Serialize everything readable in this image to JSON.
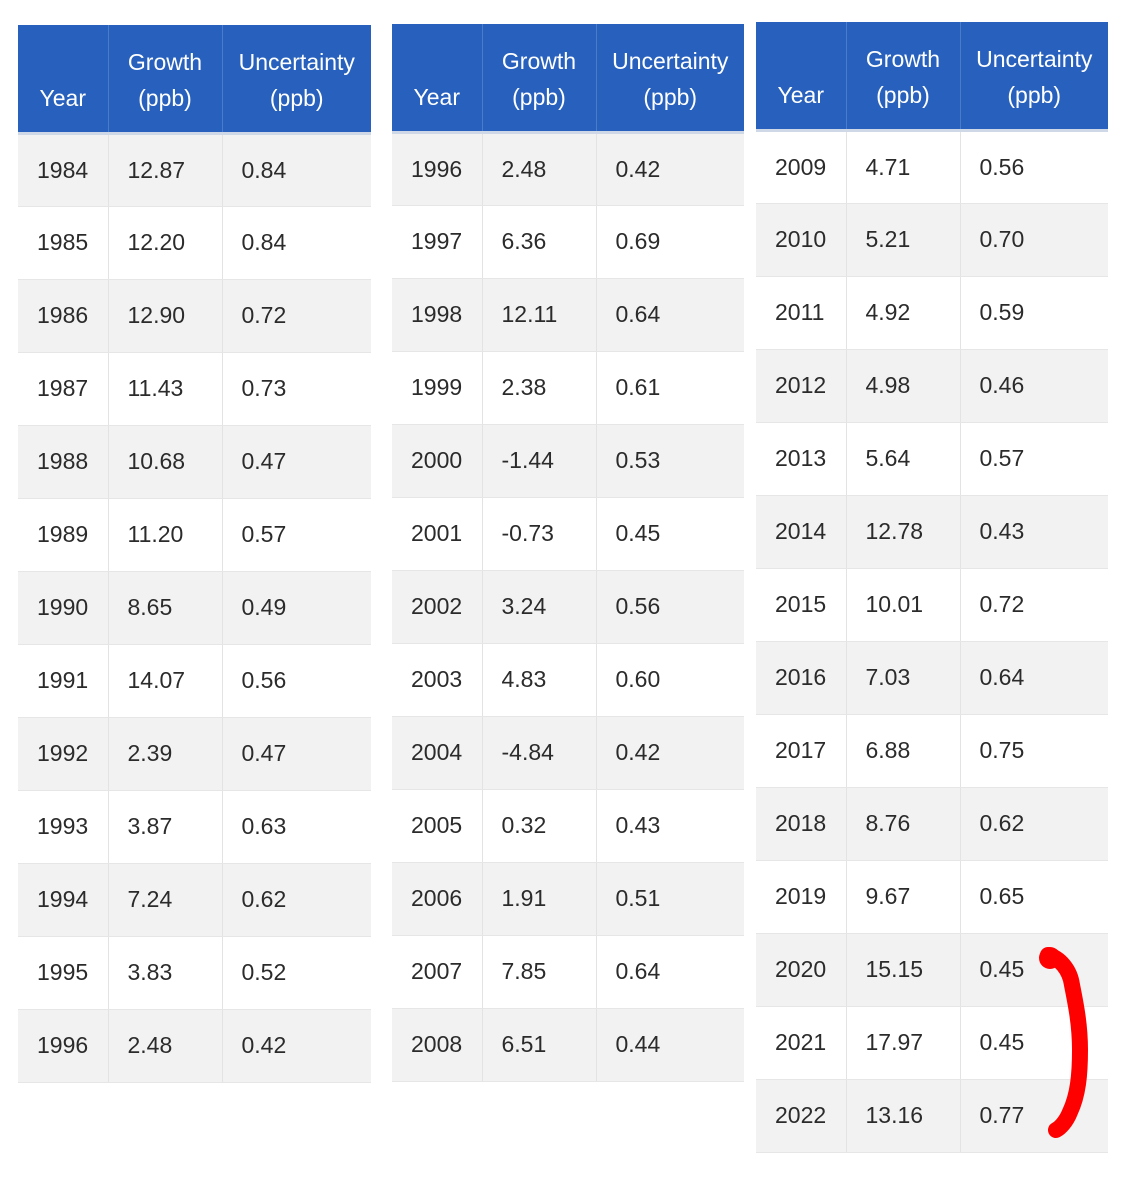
{
  "header": {
    "year": "Year",
    "growth_line1": "Growth",
    "growth_line2": "(ppb)",
    "uncertainty_line1": "Uncertainty",
    "uncertainty_line2": "(ppb)"
  },
  "tables": [
    {
      "rows": [
        {
          "year": "1984",
          "growth": "12.87",
          "uncertainty": "0.84"
        },
        {
          "year": "1985",
          "growth": "12.20",
          "uncertainty": "0.84"
        },
        {
          "year": "1986",
          "growth": "12.90",
          "uncertainty": "0.72"
        },
        {
          "year": "1987",
          "growth": "11.43",
          "uncertainty": "0.73"
        },
        {
          "year": "1988",
          "growth": "10.68",
          "uncertainty": "0.47"
        },
        {
          "year": "1989",
          "growth": "11.20",
          "uncertainty": "0.57"
        },
        {
          "year": "1990",
          "growth": "8.65",
          "uncertainty": "0.49"
        },
        {
          "year": "1991",
          "growth": "14.07",
          "uncertainty": "0.56"
        },
        {
          "year": "1992",
          "growth": "2.39",
          "uncertainty": "0.47"
        },
        {
          "year": "1993",
          "growth": "3.87",
          "uncertainty": "0.63"
        },
        {
          "year": "1994",
          "growth": "7.24",
          "uncertainty": "0.62"
        },
        {
          "year": "1995",
          "growth": "3.83",
          "uncertainty": "0.52"
        },
        {
          "year": "1996",
          "growth": "2.48",
          "uncertainty": "0.42"
        }
      ]
    },
    {
      "rows": [
        {
          "year": "1996",
          "growth": "2.48",
          "uncertainty": "0.42"
        },
        {
          "year": "1997",
          "growth": "6.36",
          "uncertainty": "0.69"
        },
        {
          "year": "1998",
          "growth": "12.11",
          "uncertainty": "0.64"
        },
        {
          "year": "1999",
          "growth": "2.38",
          "uncertainty": "0.61"
        },
        {
          "year": "2000",
          "growth": "-1.44",
          "uncertainty": "0.53"
        },
        {
          "year": "2001",
          "growth": "-0.73",
          "uncertainty": "0.45"
        },
        {
          "year": "2002",
          "growth": "3.24",
          "uncertainty": "0.56"
        },
        {
          "year": "2003",
          "growth": "4.83",
          "uncertainty": "0.60"
        },
        {
          "year": "2004",
          "growth": "-4.84",
          "uncertainty": "0.42"
        },
        {
          "year": "2005",
          "growth": "0.32",
          "uncertainty": "0.43"
        },
        {
          "year": "2006",
          "growth": "1.91",
          "uncertainty": "0.51"
        },
        {
          "year": "2007",
          "growth": "7.85",
          "uncertainty": "0.64"
        },
        {
          "year": "2008",
          "growth": "6.51",
          "uncertainty": "0.44"
        }
      ]
    },
    {
      "rows": [
        {
          "year": "2009",
          "growth": "4.71",
          "uncertainty": "0.56"
        },
        {
          "year": "2010",
          "growth": "5.21",
          "uncertainty": "0.70"
        },
        {
          "year": "2011",
          "growth": "4.92",
          "uncertainty": "0.59"
        },
        {
          "year": "2012",
          "growth": "4.98",
          "uncertainty": "0.46"
        },
        {
          "year": "2013",
          "growth": "5.64",
          "uncertainty": "0.57"
        },
        {
          "year": "2014",
          "growth": "12.78",
          "uncertainty": "0.43"
        },
        {
          "year": "2015",
          "growth": "10.01",
          "uncertainty": "0.72"
        },
        {
          "year": "2016",
          "growth": "7.03",
          "uncertainty": "0.64"
        },
        {
          "year": "2017",
          "growth": "6.88",
          "uncertainty": "0.75"
        },
        {
          "year": "2018",
          "growth": "8.76",
          "uncertainty": "0.62"
        },
        {
          "year": "2019",
          "growth": "9.67",
          "uncertainty": "0.65"
        },
        {
          "year": "2020",
          "growth": "15.15",
          "uncertainty": "0.45"
        },
        {
          "year": "2021",
          "growth": "17.97",
          "uncertainty": "0.45"
        },
        {
          "year": "2022",
          "growth": "13.16",
          "uncertainty": "0.77"
        }
      ]
    }
  ],
  "colors": {
    "header_bg": "#2861bd",
    "header_text": "#ffffff",
    "row_shade": "#f2f2f2",
    "annotation": "#ff0000"
  }
}
